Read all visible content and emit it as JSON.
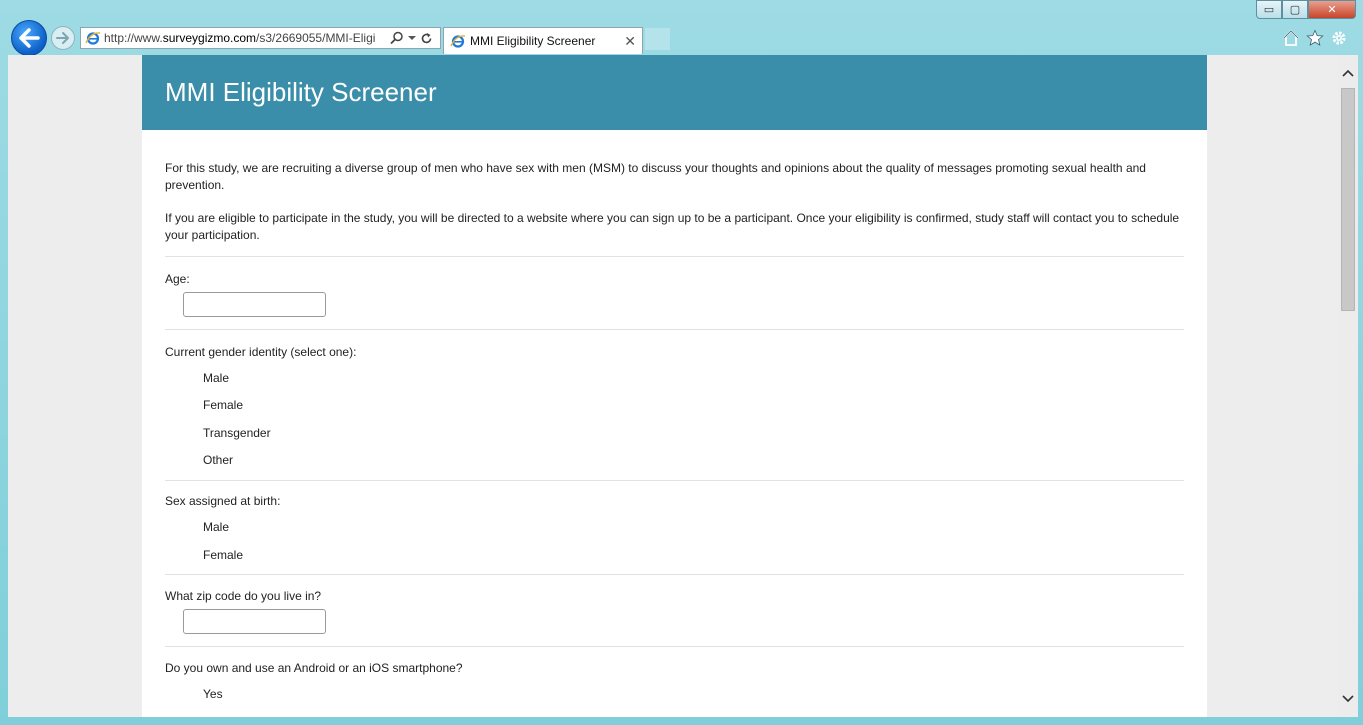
{
  "browser": {
    "url_prefix": "http://www.",
    "url_domain": "surveygizmo.com",
    "url_path": "/s3/2669055/MMI-Eligi",
    "tab_title": "MMI Eligibility Screener",
    "close_label": "✕",
    "window_buttons": {
      "minimize": "▭",
      "maximize": "▢",
      "close": "✕"
    }
  },
  "survey": {
    "title": "MMI Eligibility Screener",
    "intro_paragraphs": [
      "For this study, we are recruiting a diverse group of men who have sex with men (MSM) to discuss your thoughts and opinions about the quality of messages promoting sexual health and prevention.",
      "If you are eligible to participate in the study, you will be directed to a website where you can sign up to be a participant. Once your eligibility is confirmed, study staff will contact you to schedule your participation."
    ],
    "questions": {
      "age": {
        "label": "Age:",
        "value": ""
      },
      "gender": {
        "label": "Current gender identity (select one):",
        "options": [
          "Male",
          "Female",
          "Transgender",
          "Other"
        ]
      },
      "sex": {
        "label": "Sex assigned at birth:",
        "options": [
          "Male",
          "Female"
        ]
      },
      "zip": {
        "label": "What zip code do you live in?",
        "value": ""
      },
      "smartphone": {
        "label": "Do you own and use an Android or an iOS smartphone?",
        "options": [
          "Yes"
        ]
      }
    }
  }
}
